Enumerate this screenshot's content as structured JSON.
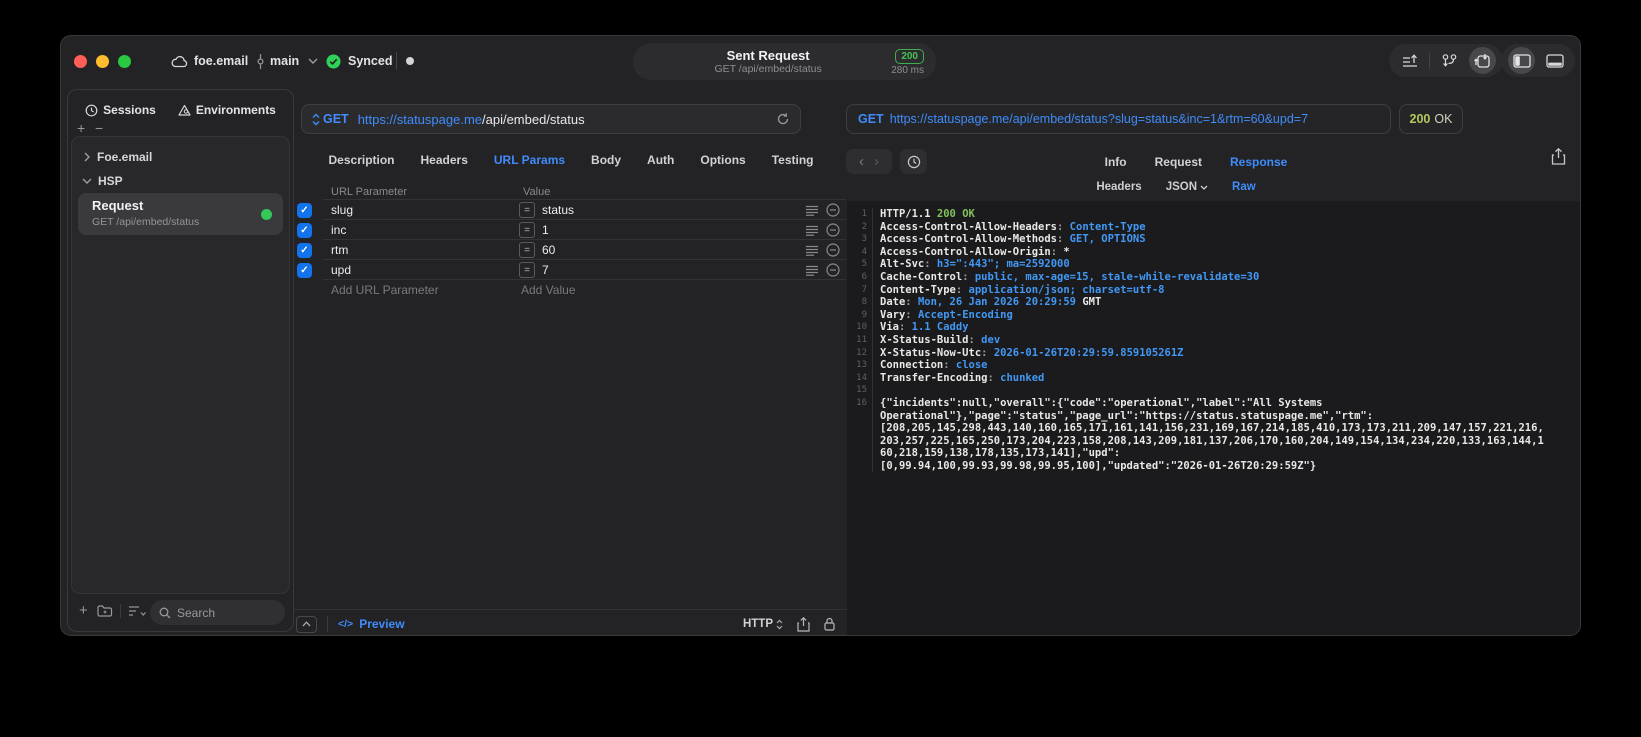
{
  "titlebar": {
    "workspace": "foe.email",
    "branch": "main",
    "sync_label": "Synced",
    "request_title": "Sent Request",
    "request_subtitle": "GET /api/embed/status",
    "status_badge": "200",
    "duration": "280 ms"
  },
  "sidebar": {
    "tab_sessions": "Sessions",
    "tab_environments": "Environments",
    "group_foe": "Foe.email",
    "group_hsp": "HSP",
    "request_title": "Request",
    "request_subtitle": "GET /api/embed/status",
    "search_placeholder": "Search"
  },
  "request_editor": {
    "method": "GET",
    "url_host": "https://statuspage.me",
    "url_path": "/api/embed/status",
    "tabs": [
      "Description",
      "Headers",
      "URL Params",
      "Body",
      "Auth",
      "Options",
      "Testing"
    ],
    "active_tab": "URL Params",
    "param_col_header": "URL Parameter",
    "value_col_header": "Value",
    "params": [
      {
        "name": "slug",
        "value": "status",
        "enabled": true
      },
      {
        "name": "inc",
        "value": "1",
        "enabled": true
      },
      {
        "name": "rtm",
        "value": "60",
        "enabled": true
      },
      {
        "name": "upd",
        "value": "7",
        "enabled": true
      }
    ],
    "add_param_placeholder": "Add URL Parameter",
    "add_value_placeholder": "Add Value",
    "preview_label": "Preview",
    "code_glyph": "</>",
    "protocol_selector": "HTTP"
  },
  "response_viewer": {
    "method": "GET",
    "url": "https://statuspage.me/api/embed/status?slug=status&inc=1&rtm=60&upd=7",
    "status_code": "200",
    "status_text": "OK",
    "tabs": [
      "Info",
      "Request",
      "Response"
    ],
    "active_tab": "Response",
    "subtab_headers": "Headers",
    "subtab_json": "JSON",
    "subtab_raw": "Raw",
    "code_lines": [
      {
        "n": "1",
        "parts": [
          [
            "HTTP/1.1 ",
            "w"
          ],
          [
            "200 OK",
            "g"
          ]
        ]
      },
      {
        "n": "2",
        "parts": [
          [
            "Access-Control-Allow-Headers",
            "w"
          ],
          [
            ": ",
            "d"
          ],
          [
            "Content-Type",
            "b"
          ]
        ]
      },
      {
        "n": "3",
        "parts": [
          [
            "Access-Control-Allow-Methods",
            "w"
          ],
          [
            ": ",
            "d"
          ],
          [
            "GET, OPTIONS",
            "b"
          ]
        ]
      },
      {
        "n": "4",
        "parts": [
          [
            "Access-Control-Allow-Origin",
            "w"
          ],
          [
            ": ",
            "d"
          ],
          [
            "*",
            "w"
          ]
        ]
      },
      {
        "n": "5",
        "parts": [
          [
            "Alt-Svc",
            "w"
          ],
          [
            ": ",
            "d"
          ],
          [
            "h3=\":443\"; ma=2592000",
            "b"
          ]
        ]
      },
      {
        "n": "6",
        "parts": [
          [
            "Cache-Control",
            "w"
          ],
          [
            ": ",
            "d"
          ],
          [
            "public, max-age=15, stale-while-revalidate=30",
            "b"
          ]
        ]
      },
      {
        "n": "7",
        "parts": [
          [
            "Content-Type",
            "w"
          ],
          [
            ": ",
            "d"
          ],
          [
            "application/json; charset=utf-8",
            "b"
          ]
        ]
      },
      {
        "n": "8",
        "parts": [
          [
            "Date",
            "w"
          ],
          [
            ": ",
            "d"
          ],
          [
            "Mon, 26 Jan 2026 20:29:59 ",
            "b"
          ],
          [
            "GMT",
            "w"
          ]
        ]
      },
      {
        "n": "9",
        "parts": [
          [
            "Vary",
            "w"
          ],
          [
            ": ",
            "d"
          ],
          [
            "Accept-Encoding",
            "b"
          ]
        ]
      },
      {
        "n": "10",
        "parts": [
          [
            "Via",
            "w"
          ],
          [
            ": ",
            "d"
          ],
          [
            "1.1 Caddy",
            "b"
          ]
        ]
      },
      {
        "n": "11",
        "parts": [
          [
            "X-Status-Build",
            "w"
          ],
          [
            ": ",
            "d"
          ],
          [
            "dev",
            "b"
          ]
        ]
      },
      {
        "n": "12",
        "parts": [
          [
            "X-Status-Now-Utc",
            "w"
          ],
          [
            ": ",
            "d"
          ],
          [
            "2026-01-26T20:29:59.859105261Z",
            "b"
          ]
        ]
      },
      {
        "n": "13",
        "parts": [
          [
            "Connection",
            "w"
          ],
          [
            ": ",
            "d"
          ],
          [
            "close",
            "b"
          ]
        ]
      },
      {
        "n": "14",
        "parts": [
          [
            "Transfer-Encoding",
            "w"
          ],
          [
            ": ",
            "d"
          ],
          [
            "chunked",
            "b"
          ]
        ]
      },
      {
        "n": "15",
        "parts": []
      },
      {
        "n": "16",
        "parts": [
          [
            "{\"incidents\":null,\"overall\":{\"code\":\"operational\",\"label\":\"All Systems",
            "w"
          ]
        ]
      },
      {
        "n": "",
        "parts": [
          [
            "Operational\"},\"page\":\"status\",\"page_url\":\"https://status.statuspage.me\",\"rtm\":",
            "w"
          ]
        ]
      },
      {
        "n": "",
        "parts": [
          [
            "[208,205,145,298,443,140,160,165,171,161,141,156,231,169,167,214,185,410,173,173,211,209,147,157,221,216,",
            "w"
          ]
        ]
      },
      {
        "n": "",
        "parts": [
          [
            "203,257,225,165,250,173,204,223,158,208,143,209,181,137,206,170,160,204,149,154,134,234,220,133,163,144,1",
            "w"
          ]
        ]
      },
      {
        "n": "",
        "parts": [
          [
            "60,218,159,138,178,135,173,141],\"upd\":",
            "w"
          ]
        ]
      },
      {
        "n": "",
        "parts": [
          [
            "[0,99.94,100,99.93,99.98,99.95,100],\"updated\":\"2026-01-26T20:29:59Z\"}",
            "w"
          ]
        ]
      }
    ]
  },
  "icons": {
    "plus": "+",
    "minus": "−",
    "equals": "=",
    "check": "✓",
    "back": "‹",
    "forward": "›"
  },
  "colors": {
    "accent_blue": "#3f8cfa",
    "code_blue": "#4198f5",
    "code_green": "#82c05a",
    "status_green": "#34c759",
    "status_yellow_green": "#b3c95c"
  }
}
